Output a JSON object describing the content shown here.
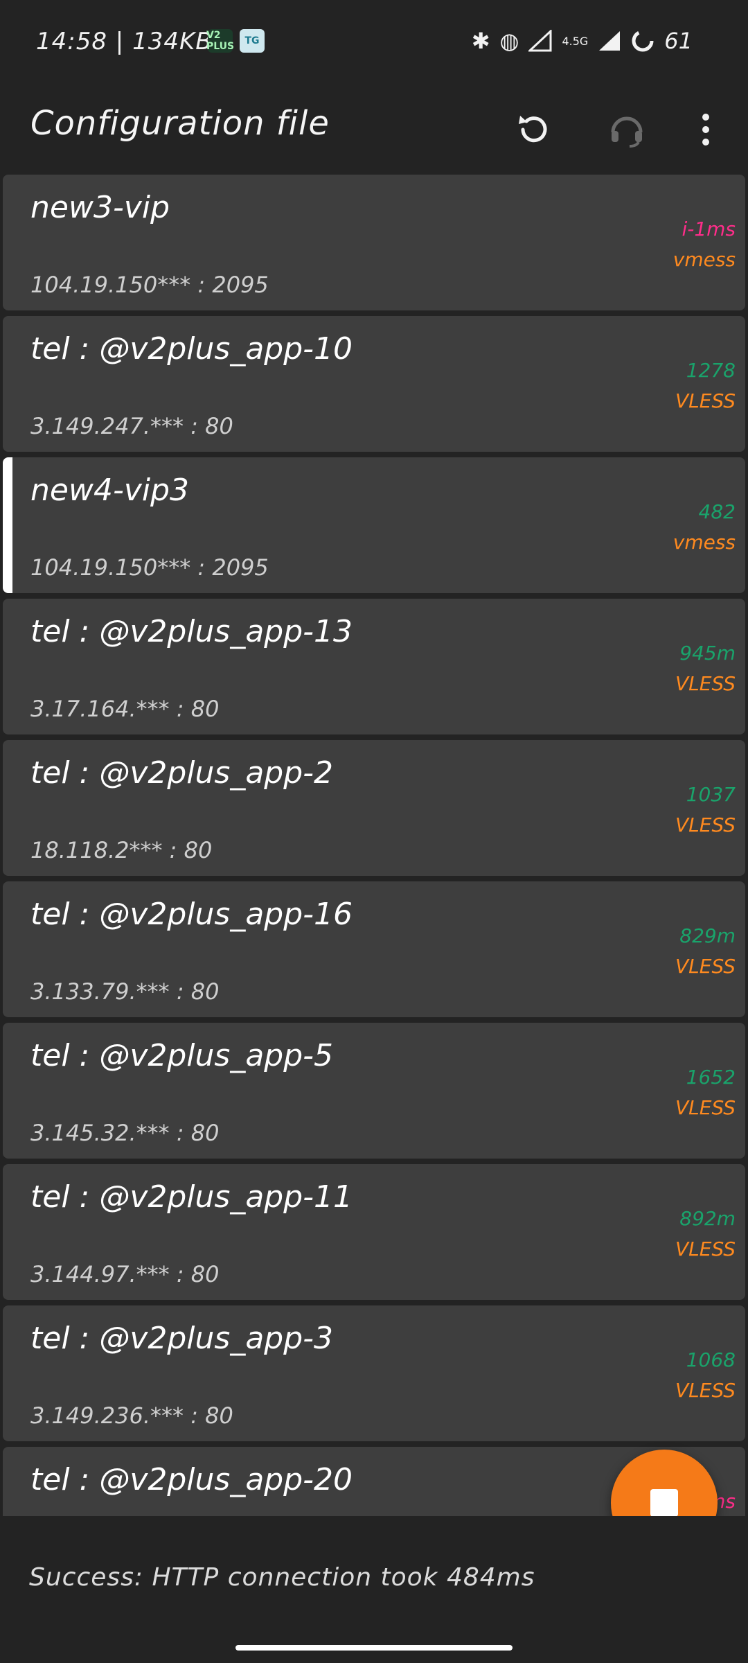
{
  "status_bar": {
    "time": "14:58",
    "speed": "134KB/s",
    "app_icon_1": "V2 PLUS",
    "app_icon_2": "TG",
    "network": "4.5G",
    "battery": "61",
    "icons": [
      "bluetooth-icon",
      "vpn-icon",
      "signal-icon",
      "signal-icon",
      "battery-icon"
    ]
  },
  "app_bar": {
    "title": "Configuration file",
    "actions": [
      "refresh-icon",
      "support-icon",
      "more-vert-icon"
    ]
  },
  "colors": {
    "latency_green": "#1aa36b",
    "latency_pink": "#ff2d8a",
    "protocol_orange": "#ff8a1f",
    "fab_orange": "#f57a18",
    "card_bg": "#3e3e3e",
    "app_bg": "#232323"
  },
  "configs": [
    {
      "name": "new3-vip",
      "address": "104.19.150*** : 2095",
      "latency": "i-1ms",
      "latency_color": "#ff2d8a",
      "protocol": "vmess",
      "selected": false
    },
    {
      "name": "tel : @v2plus_app-10",
      "address": "3.149.247.*** : 80",
      "latency": "1278",
      "latency_color": "#1aa36b",
      "protocol": "VLESS",
      "selected": false
    },
    {
      "name": "new4-vip3",
      "address": "104.19.150*** : 2095",
      "latency": "482",
      "latency_color": "#1aa36b",
      "protocol": "vmess",
      "selected": true
    },
    {
      "name": "tel : @v2plus_app-13",
      "address": "3.17.164.*** : 80",
      "latency": "945m",
      "latency_color": "#1aa36b",
      "protocol": "VLESS",
      "selected": false
    },
    {
      "name": "tel : @v2plus_app-2",
      "address": "18.118.2*** : 80",
      "latency": "1037",
      "latency_color": "#1aa36b",
      "protocol": "VLESS",
      "selected": false
    },
    {
      "name": "tel : @v2plus_app-16",
      "address": "3.133.79.*** : 80",
      "latency": "829m",
      "latency_color": "#1aa36b",
      "protocol": "VLESS",
      "selected": false
    },
    {
      "name": "tel : @v2plus_app-5",
      "address": "3.145.32.*** : 80",
      "latency": "1652",
      "latency_color": "#1aa36b",
      "protocol": "VLESS",
      "selected": false
    },
    {
      "name": "tel : @v2plus_app-11",
      "address": "3.144.97.*** : 80",
      "latency": "892m",
      "latency_color": "#1aa36b",
      "protocol": "VLESS",
      "selected": false
    },
    {
      "name": "tel : @v2plus_app-3",
      "address": "3.149.236.*** : 80",
      "latency": "1068",
      "latency_color": "#1aa36b",
      "protocol": "VLESS",
      "selected": false
    },
    {
      "name": "tel : @v2plus_app-20",
      "address": "",
      "latency": "ms",
      "latency_color": "#ff2d8a",
      "protocol": "",
      "selected": false
    }
  ],
  "fab": {
    "icon": "stop-icon"
  },
  "bottom_status": {
    "text": "Success: HTTP connection took 484ms"
  }
}
